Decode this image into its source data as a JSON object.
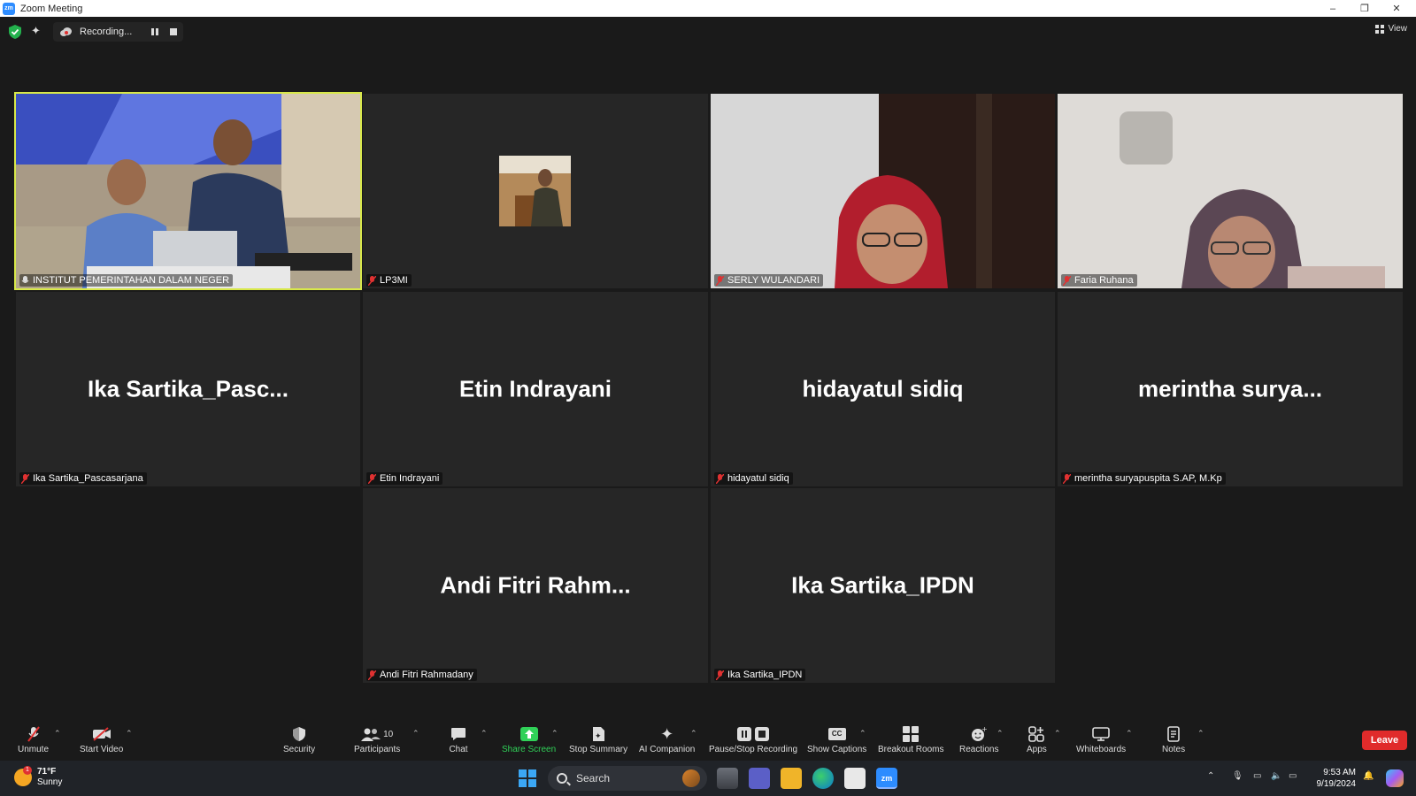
{
  "window": {
    "app_logo": "zm",
    "title": "Zoom Meeting",
    "controls": [
      "–",
      "❐",
      "✕"
    ]
  },
  "topbar": {
    "recording_label": "Recording...",
    "view_label": "View"
  },
  "tiles": [
    {
      "id": "t1",
      "name": "INSTITUT PEMERINTAHAN DALAM NEGER",
      "video": true,
      "active": true
    },
    {
      "id": "t2",
      "name": "LP3MI",
      "video": true
    },
    {
      "id": "t3",
      "name": "SERLY WULANDARI",
      "video": true
    },
    {
      "id": "t4",
      "name": "Faria Ruhana",
      "video": true
    },
    {
      "id": "t5",
      "name": "Ika Sartika_Pascasarjana",
      "display": "Ika  Sartika_Pasc..."
    },
    {
      "id": "t6",
      "name": "Etin Indrayani",
      "display": "Etin Indrayani"
    },
    {
      "id": "t7",
      "name": "hidayatul sidiq",
      "display": "hidayatul sidiq"
    },
    {
      "id": "t8",
      "name": "merintha suryapuspita S.AP, M.Kp",
      "display": "merintha  surya..."
    },
    {
      "id": "t9",
      "name": "Andi Fitri Rahmadany",
      "display": "Andi  Fitri  Rahm..."
    },
    {
      "id": "t10",
      "name": "Ika Sartika_IPDN",
      "display": "Ika Sartika_IPDN"
    }
  ],
  "toolbar": {
    "unmute": "Unmute",
    "start_video": "Start Video",
    "security": "Security",
    "participants": "Participants",
    "participants_count": "10",
    "chat": "Chat",
    "share_screen": "Share Screen",
    "stop_summary": "Stop Summary",
    "ai_companion": "AI Companion",
    "pause_stop_recording": "Pause/Stop Recording",
    "show_captions": "Show Captions",
    "breakout_rooms": "Breakout Rooms",
    "reactions": "Reactions",
    "apps": "Apps",
    "whiteboards": "Whiteboards",
    "notes": "Notes",
    "leave": "Leave",
    "captions_icon_text": "CC"
  },
  "taskbar": {
    "weather_temp": "71°F",
    "weather_desc": "Sunny",
    "weather_badge": "1",
    "search_placeholder": "Search",
    "zoom_app_label": "zm",
    "time": "9:53 AM",
    "date": "9/19/2024"
  },
  "colors": {
    "active_speaker": "#d8e84a",
    "leave": "#e02b2b",
    "share_green": "#30d158",
    "muted_red": "#e03131"
  }
}
